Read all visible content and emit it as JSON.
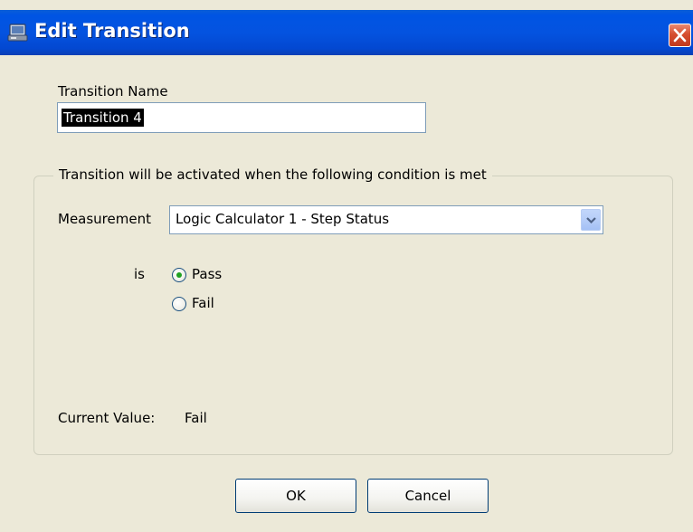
{
  "window": {
    "title": "Edit Transition"
  },
  "transition_name": {
    "label": "Transition Name",
    "value": "Transition 4"
  },
  "condition_group": {
    "caption": "Transition will be activated when the following condition is met",
    "measurement": {
      "label": "Measurement",
      "selected": "Logic Calculator 1 - Step Status"
    },
    "is_label": "is",
    "options": [
      {
        "label": "Pass",
        "checked": true
      },
      {
        "label": "Fail",
        "checked": false
      }
    ],
    "current_value": {
      "label": "Current Value:",
      "value": "Fail"
    }
  },
  "buttons": {
    "ok": "OK",
    "cancel": "Cancel"
  },
  "icons": {
    "app": "app-window-icon",
    "close": "close-x-icon",
    "dropdown": "chevron-down-icon"
  },
  "colors": {
    "titlebar": "#0453e0",
    "dialog_bg": "#ece9d8",
    "close_button": "#d64e2f",
    "radio_dot": "#21a121"
  }
}
